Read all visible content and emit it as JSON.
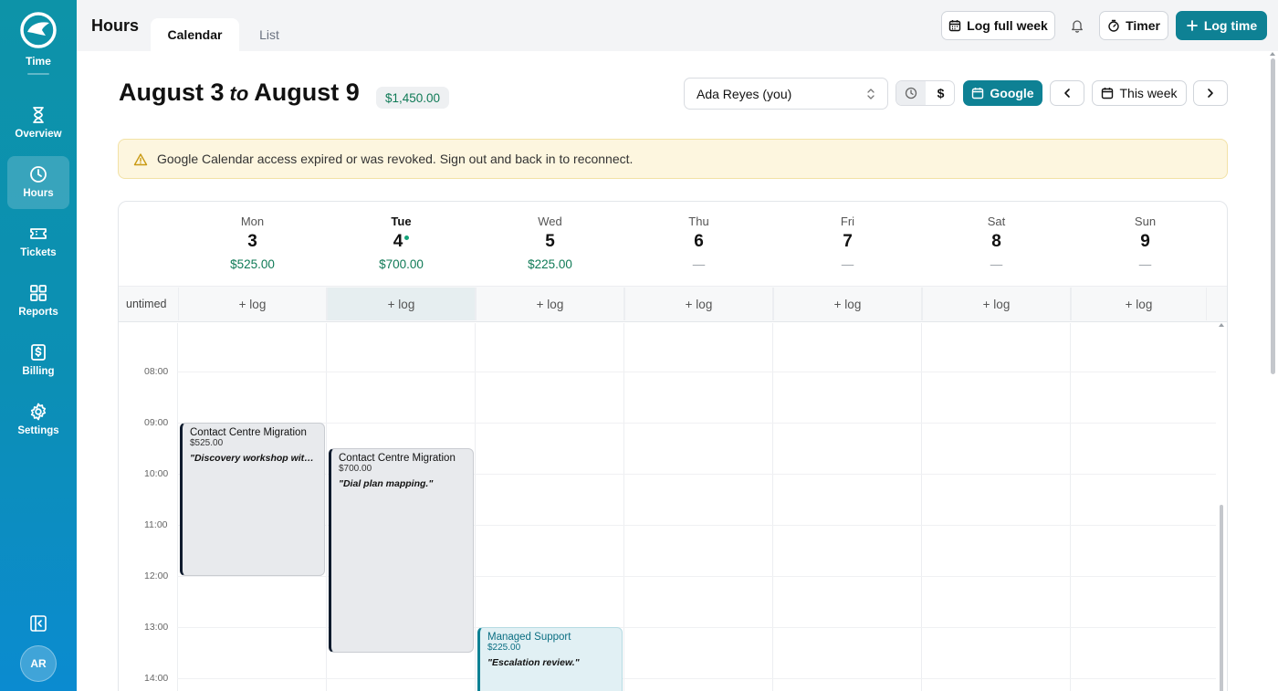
{
  "sidebar": {
    "brand_label": "Time",
    "items": [
      {
        "label": "Overview",
        "icon": "hourglass-icon",
        "active": false
      },
      {
        "label": "Hours",
        "icon": "clock-icon",
        "active": true
      },
      {
        "label": "Tickets",
        "icon": "ticket-icon",
        "active": false
      },
      {
        "label": "Reports",
        "icon": "grid-icon",
        "active": false
      },
      {
        "label": "Billing",
        "icon": "dollar-receipt-icon",
        "active": false
      },
      {
        "label": "Settings",
        "icon": "gear-icon",
        "active": false
      }
    ],
    "avatar_initials": "AR"
  },
  "header": {
    "title": "Hours",
    "tabs": [
      {
        "label": "Calendar",
        "active": true
      },
      {
        "label": "List",
        "active": false
      }
    ],
    "log_full_week_label": "Log full week",
    "timer_label": "Timer",
    "log_time_label": "Log time"
  },
  "week": {
    "start": "August 3",
    "connector": "to",
    "end": "August 9",
    "total": "$1,450.00"
  },
  "controls": {
    "user": "Ada Reyes (you)",
    "currency_symbol": "$",
    "google_label": "Google",
    "this_week_label": "This week"
  },
  "banner": {
    "message": "Google Calendar access expired or was revoked. Sign out and back in to reconnect."
  },
  "calendar": {
    "untimed_label": "untimed",
    "log_label": "+ log",
    "days": [
      {
        "name": "Mon",
        "num": "3",
        "total": "$525.00",
        "today": false
      },
      {
        "name": "Tue",
        "num": "4",
        "total": "$700.00",
        "today": true
      },
      {
        "name": "Wed",
        "num": "5",
        "total": "$225.00",
        "today": false
      },
      {
        "name": "Thu",
        "num": "6",
        "total": "—",
        "today": false
      },
      {
        "name": "Fri",
        "num": "7",
        "total": "—",
        "today": false
      },
      {
        "name": "Sat",
        "num": "8",
        "total": "—",
        "today": false
      },
      {
        "name": "Sun",
        "num": "9",
        "total": "—",
        "today": false
      }
    ],
    "times": [
      "08:00",
      "09:00",
      "10:00",
      "11:00",
      "12:00",
      "13:00",
      "14:00"
    ],
    "events": [
      {
        "day": 0,
        "start": "09:00",
        "end": "12:00",
        "title": "Contact Centre Migration",
        "amount": "$525.00",
        "note": "\"Discovery workshop with ...",
        "color": "#0f1b2d"
      },
      {
        "day": 1,
        "start": "09:30",
        "end": "13:30",
        "title": "Contact Centre Migration",
        "amount": "$700.00",
        "note": "\"Dial plan mapping.\"",
        "color": "#0f1b2d"
      },
      {
        "day": 2,
        "start": "13:00",
        "end": "14:30",
        "title": "Managed Support",
        "amount": "$225.00",
        "note": "\"Escalation review.\"",
        "color": "#0e8194"
      }
    ]
  },
  "colors": {
    "accent": "#0e8194",
    "money": "#0f7a56",
    "banner_bg": "#fdf6df"
  }
}
